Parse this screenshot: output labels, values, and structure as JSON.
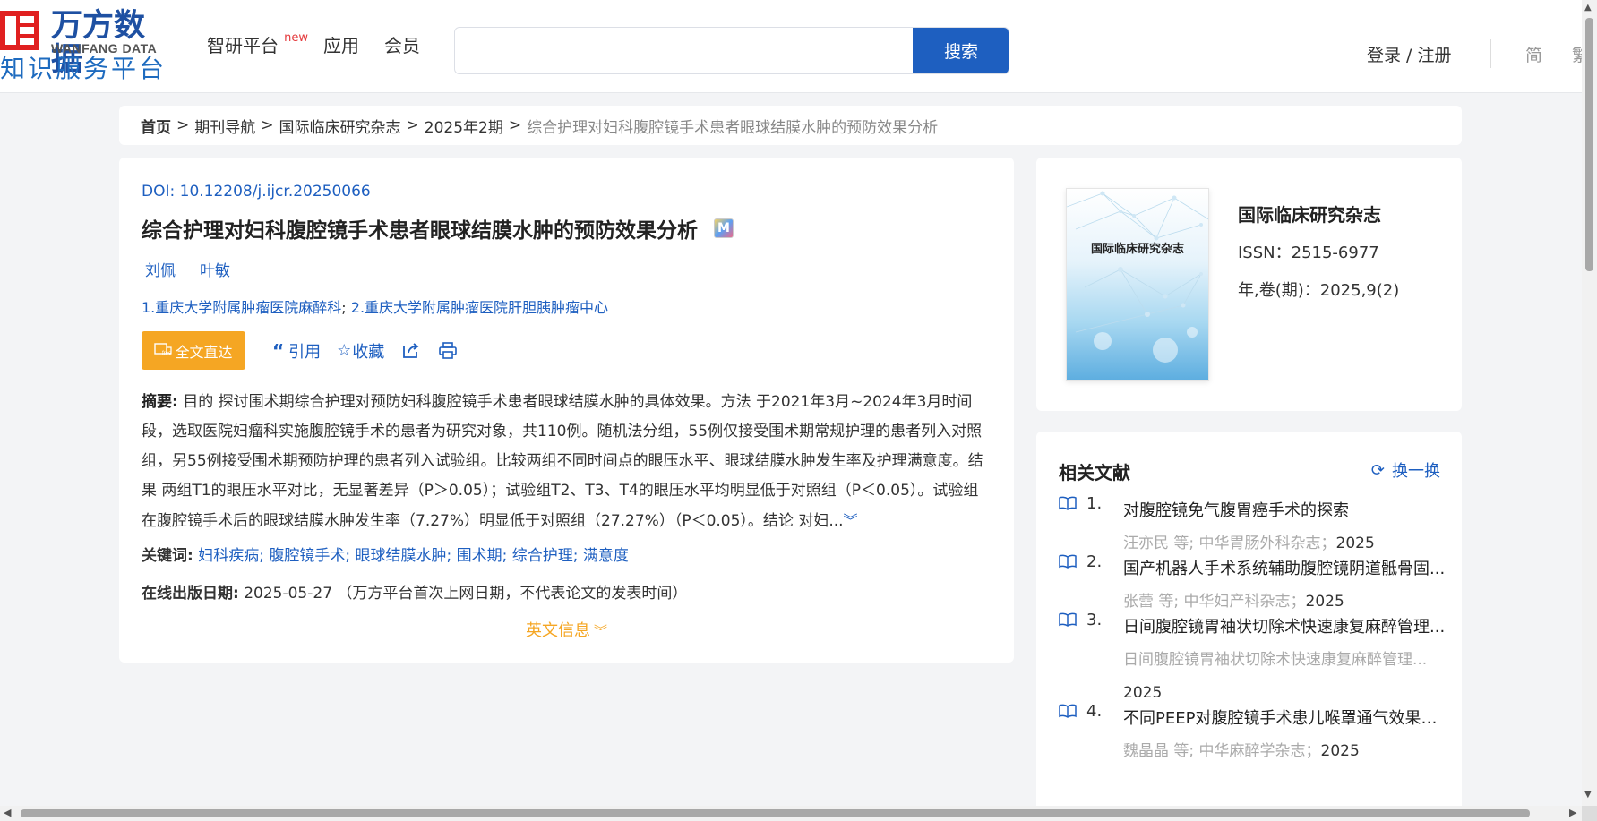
{
  "header": {
    "logo_cn": "万方数据",
    "logo_en": "WANFANG DATA",
    "logo_platform": "知识服务平台",
    "nav": [
      {
        "label": "智研平台",
        "badge": "new"
      },
      {
        "label": "应用"
      },
      {
        "label": "会员"
      }
    ],
    "search": {
      "placeholder": "",
      "button_label": "搜索"
    },
    "login_label": "登录 / 注册",
    "lang_simplified": "简",
    "lang_traditional": "繁"
  },
  "breadcrumb": {
    "items": [
      "首页",
      "期刊导航",
      "国际临床研究杂志",
      "2025年2期"
    ],
    "separator": ">",
    "current": "综合护理对妇科腹腔镜手术患者眼球结膜水肿的预防效果分析"
  },
  "article": {
    "doi_label": "DOI: ",
    "doi_value": "10.12208/j.ijcr.20250066",
    "title": "综合护理对妇科腹腔镜手术患者眼球结膜水肿的预防效果分析",
    "title_badge": "M",
    "authors": [
      "刘佩",
      "叶敏"
    ],
    "affiliations": [
      {
        "prefix": "1.",
        "name": "重庆大学附属肿瘤医院麻醉科",
        "sep": "; "
      },
      {
        "prefix": "2.",
        "name": "重庆大学附属肿瘤医院肝胆胰肿瘤中心",
        "sep": ""
      }
    ],
    "actions": {
      "fulltext_label": "全文直达",
      "cite_label": "引用",
      "favorite_label": "收藏"
    },
    "abstract_label": "摘要:",
    "abstract_text": " 目的 探讨围术期综合护理对预防妇科腹腔镜手术患者眼球结膜水肿的具体效果。方法 于2021年3月~2024年3月时间段，选取医院妇瘤科实施腹腔镜手术的患者为研究对象，共110例。随机法分组，55例仅接受围术期常规护理的患者列入对照组，另55例接受围术期预防护理的患者列入试验组。比较两组不同时间点的眼压水平、眼球结膜水肿发生率及护理满意度。结果 两组T1的眼压水平对比，无显著差异（P＞0.05）；试验组T2、T3、T4的眼压水平均明显低于对照组（P＜0.05）。试验组在腹腔镜手术后的眼球结膜水肿发生率（7.27%）明显低于对照组（27.27%）（P＜0.05）。结论 对妇...",
    "keywords_label": "关键词:",
    "keywords": [
      "妇科疾病",
      "腹腔镜手术",
      "眼球结膜水肿",
      "围术期",
      "综合护理",
      "满意度"
    ],
    "pubdate_label": "在线出版日期:",
    "pubdate_value": "2025-05-27",
    "pubdate_note": "（万方平台首次上网日期，不代表论文的发表时间）",
    "en_info_label": "英文信息"
  },
  "journal": {
    "cover_title": "国际临床研究杂志",
    "name": "国际临床研究杂志",
    "issn": "ISSN：2515-6977",
    "volume": "年,卷(期)：2025,9(2)"
  },
  "related": {
    "title": "相关文献",
    "refresh_label": "换一换",
    "items": [
      {
        "num": "1.",
        "title": "对腹腔镜免气腹胃癌手术的探索",
        "authors": "汪亦民  等;",
        "source": "中华胃肠外科杂志",
        "year": "2025"
      },
      {
        "num": "2.",
        "title": "国产机器人手术系统辅助腹腔镜阴道骶骨固...",
        "authors": "张蕾  等;",
        "source": "中华妇产科杂志",
        "year": "2025"
      },
      {
        "num": "3.",
        "title": "日间腹腔镜胃袖状切除术快速康复麻醉管理...",
        "authors": "日间腹腔镜胃袖状切除术快速康复麻醉管理...",
        "source": "",
        "year": "2025"
      },
      {
        "num": "4.",
        "title": "不同PEEP对腹腔镜手术患儿喉罩通气效果的...",
        "authors": "魏晶晶  等;",
        "source": "中华麻醉学杂志",
        "year": "2025"
      }
    ]
  }
}
